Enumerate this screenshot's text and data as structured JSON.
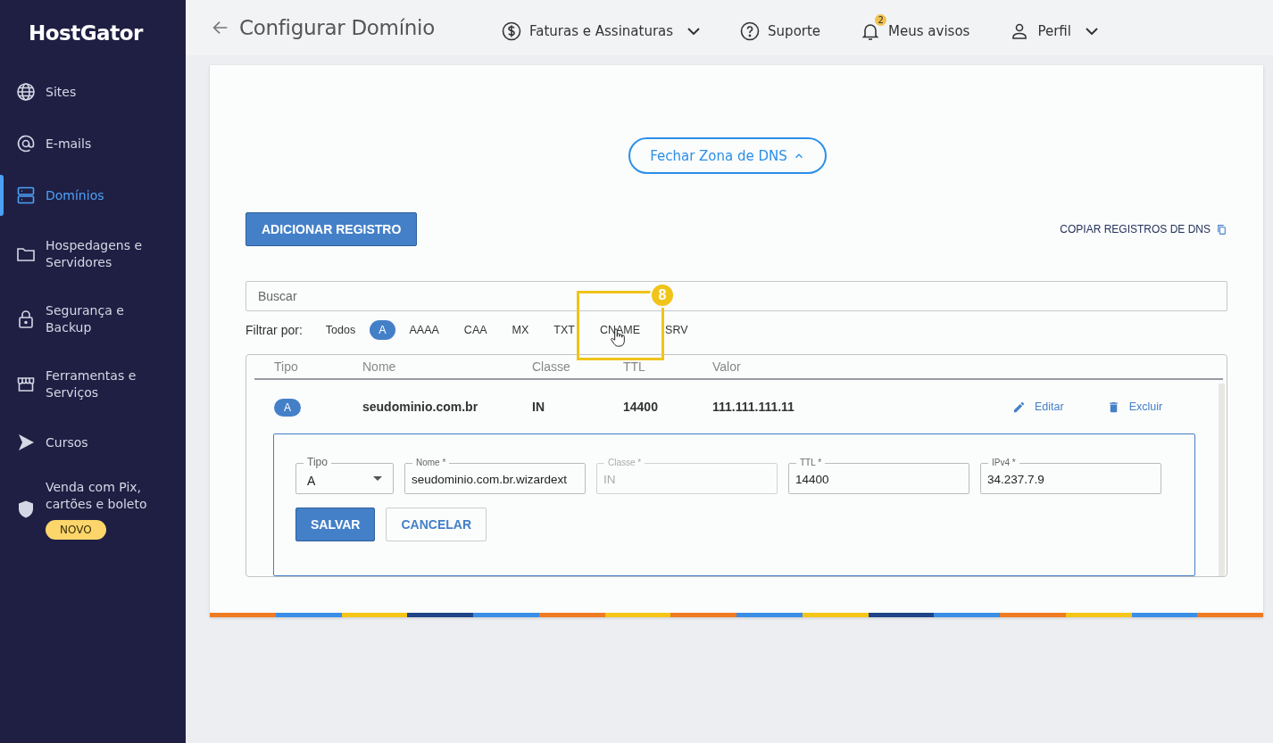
{
  "sidebar": {
    "logo": "HostGator",
    "items": [
      {
        "label": "Sites",
        "selected": false
      },
      {
        "label": "E-mails",
        "selected": false
      },
      {
        "label": "Domínios",
        "selected": true
      },
      {
        "label": "Hospedagens e Servidores",
        "selected": false
      },
      {
        "label": "Segurança e Backup",
        "selected": false
      },
      {
        "label": "Ferramentas e Serviços",
        "selected": false
      },
      {
        "label": "Cursos",
        "selected": false
      },
      {
        "label": "Venda com Pix, cartões e boleto",
        "selected": false,
        "badge": "NOVO"
      }
    ]
  },
  "header": {
    "title": "Configurar Domínio",
    "nav": [
      {
        "label": "Faturas e Assinaturas",
        "dropdown": true
      },
      {
        "label": "Suporte",
        "dropdown": false
      },
      {
        "label": "Meus avisos",
        "dropdown": false,
        "count": "2"
      },
      {
        "label": "Perfil",
        "dropdown": true
      }
    ]
  },
  "dns": {
    "toggle": "Fechar Zona de DNS",
    "expanded": true,
    "add_button": "ADICIONAR REGISTRO",
    "copy_link": "COPIAR REGISTROS DE DNS",
    "search": {
      "placeholder": "Buscar"
    },
    "filter_label": "Filtrar por:",
    "filters": [
      {
        "label": "Todos",
        "selected": false,
        "highlighted": false
      },
      {
        "label": "A",
        "selected": true,
        "highlighted": false
      },
      {
        "label": "AAAA",
        "selected": false,
        "highlighted": false
      },
      {
        "label": "CAA",
        "selected": false,
        "highlighted": false
      },
      {
        "label": "MX",
        "selected": false,
        "highlighted": false
      },
      {
        "label": "TXT",
        "selected": false,
        "highlighted": false
      },
      {
        "label": "CNAME",
        "selected": false,
        "highlighted": true
      },
      {
        "label": "SRV",
        "selected": false,
        "highlighted": false
      }
    ],
    "tutorial_step": "8",
    "table": {
      "columns": [
        "Tipo",
        "Nome",
        "Classe",
        "TTL",
        "Valor"
      ],
      "rows": [
        {
          "type": "A",
          "name": "seudominio.com.br",
          "class": "IN",
          "ttl": "14400",
          "value": "111.111.111.11",
          "actions": [
            {
              "label": "Editar",
              "kind": "edit"
            },
            {
              "label": "Excluir",
              "kind": "delete"
            }
          ]
        }
      ]
    },
    "edit_form": {
      "fields": [
        {
          "kind": "select",
          "label": "Tipo",
          "value": "A",
          "disabled": false
        },
        {
          "kind": "text",
          "label": "Nome *",
          "value": "seudominio.com.br.wizardext",
          "disabled": false
        },
        {
          "kind": "text",
          "label": "Classe *",
          "value": "IN",
          "disabled": true
        },
        {
          "kind": "text",
          "label": "TTL *",
          "value": "14400",
          "disabled": false
        },
        {
          "kind": "text",
          "label": "IPv4 *",
          "value": "34.237.7.9",
          "disabled": false
        }
      ],
      "buttons": [
        {
          "label": "SALVAR",
          "primary": true
        },
        {
          "label": "CANCELAR",
          "primary": false
        }
      ]
    }
  }
}
